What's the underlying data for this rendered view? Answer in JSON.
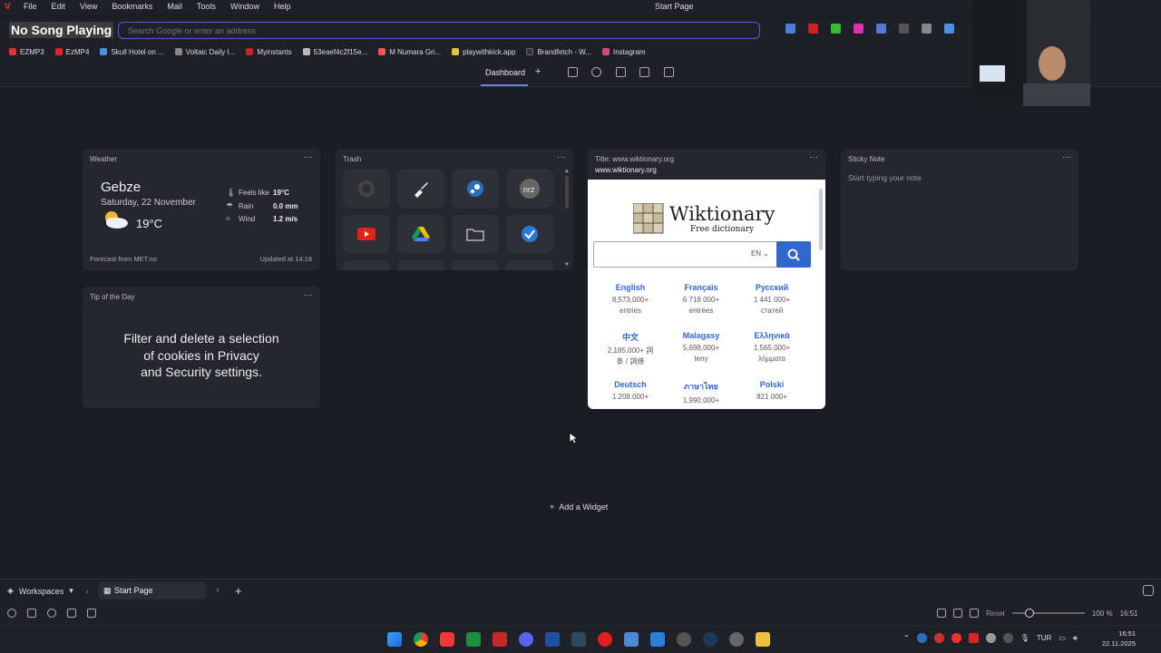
{
  "menubar": {
    "items": [
      "File",
      "Edit",
      "View",
      "Bookmarks",
      "Mail",
      "Tools",
      "Window",
      "Help"
    ],
    "title": "Start Page"
  },
  "overlay": {
    "now_playing": "No Song Playing"
  },
  "address_bar": {
    "placeholder": "Search Google or enter an address",
    "value": ""
  },
  "bookmarks": [
    {
      "label": "EZMP3",
      "color": "#d33"
    },
    {
      "label": "EzMP4",
      "color": "#e22"
    },
    {
      "label": "Skull Hotel on ...",
      "color": "#4a8fe8"
    },
    {
      "label": "Voltaic Daily I...",
      "color": "#888"
    },
    {
      "label": "Myinstants",
      "color": "#c22"
    },
    {
      "label": "53eaef4c2f15e...",
      "color": "#bbb"
    },
    {
      "label": "M Numara Gri...",
      "color": "#e55"
    },
    {
      "label": "playwithkick.app",
      "color": "#e8c23a"
    },
    {
      "label": "Brandfetch - W...",
      "color": "#333"
    },
    {
      "label": "Instagram",
      "color": "#d6497a"
    }
  ],
  "tabs": {
    "dashboard": "Dashboard",
    "add": "+"
  },
  "weather": {
    "title": "Weather",
    "city": "Gebze",
    "date": "Saturday, 22 November",
    "temp": "19°C",
    "feels_label": "Feels like",
    "feels_value": "19°C",
    "rain_label": "Rain",
    "rain_value": "0.0 mm",
    "wind_label": "Wind",
    "wind_value": "1.2 m/s",
    "source": "Forecast from MET.no",
    "updated": "Updated at 14:18"
  },
  "trash": {
    "title": "Trash"
  },
  "tip": {
    "title": "Tip of the Day",
    "lines": [
      "Filter and delete a selection",
      "of cookies in Privacy",
      "and Security settings."
    ]
  },
  "webpanel": {
    "title": "Title: www.wiktionary.org",
    "url": "www.wiktionary.org",
    "logo": "Wiktionary",
    "subtitle": "Free dictionary",
    "lang_select": "EN",
    "languages": [
      {
        "name": "English",
        "count": "8,573,000+",
        "unit": "entries"
      },
      {
        "name": "Français",
        "count": "6 718 000+",
        "unit": "entrées"
      },
      {
        "name": "Русский",
        "count": "1 441 000+",
        "unit": "статей"
      },
      {
        "name": "中文",
        "count": "2,185,000+ 詞",
        "unit": "条 / 詞條"
      },
      {
        "name": "Malagasy",
        "count": "5,698,000+",
        "unit": "teny"
      },
      {
        "name": "Ελληνικά",
        "count": "1.565.000+",
        "unit": "λήμματα"
      },
      {
        "name": "Deutsch",
        "count": "1.208.000+",
        "unit": ""
      },
      {
        "name": "ภาษาไทย",
        "count": "1,990,000+",
        "unit": ""
      },
      {
        "name": "Polski",
        "count": "821 000+",
        "unit": ""
      }
    ]
  },
  "sticky": {
    "title": "Sticky Note",
    "placeholder": "Start typing your note"
  },
  "add_widget": "Add a Widget",
  "bottom": {
    "workspaces": "Workspaces",
    "tab": "Start Page",
    "reset": "Reset",
    "zoom": "100 %",
    "time_short": "16:51"
  },
  "tray": {
    "lang": "TUR",
    "time": "16:51",
    "date": "22.11.2025"
  }
}
